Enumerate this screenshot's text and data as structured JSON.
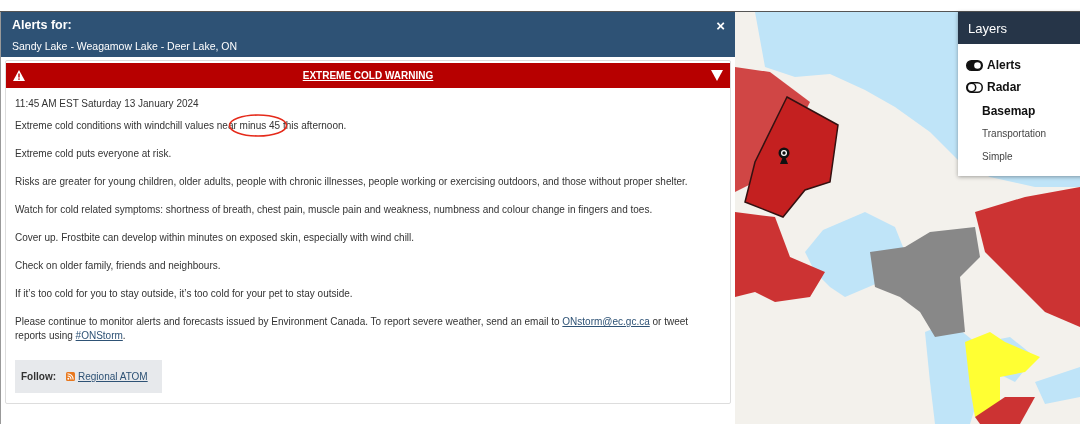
{
  "alert_panel": {
    "title": "Alerts for:",
    "location": "Sandy Lake - Weagamow Lake - Deer Lake, ON",
    "close": "×",
    "warning": {
      "title": "EXTREME COLD WARNING"
    },
    "issued": "11:45 AM EST Saturday 13 January 2024",
    "paragraphs": [
      [
        {
          "kind": "text",
          "text": "Extreme cold conditions with windchill values near "
        },
        {
          "kind": "circled",
          "text": "minus 45"
        },
        {
          "kind": "text",
          "text": " this afternoon."
        }
      ],
      [
        {
          "kind": "text",
          "text": "Extreme cold puts everyone at risk."
        }
      ],
      [
        {
          "kind": "text",
          "text": "Risks are greater for young children, older adults, people with chronic illnesses, people working or exercising outdoors, and those without proper shelter."
        }
      ],
      [
        {
          "kind": "text",
          "text": "Watch for cold related symptoms: shortness of breath, chest pain, muscle pain and weakness, numbness and colour change in fingers and toes."
        }
      ],
      [
        {
          "kind": "text",
          "text": "Cover up. Frostbite can develop within minutes on exposed skin, especially with wind chill."
        }
      ],
      [
        {
          "kind": "text",
          "text": "Check on older family, friends and neighbours."
        }
      ],
      [
        {
          "kind": "text",
          "text": "If it’s too cold for you to stay outside, it’s too cold for your pet to stay outside."
        }
      ],
      [
        {
          "kind": "text",
          "text": "Please continue to monitor alerts and forecasts issued by Environment Canada. To report severe weather, send an email to "
        },
        {
          "kind": "link",
          "text": "ONstorm@ec.gc.ca"
        },
        {
          "kind": "text",
          "text": " or tweet reports using "
        },
        {
          "kind": "link",
          "text": "#ONStorm"
        },
        {
          "kind": "text",
          "text": "."
        }
      ]
    ],
    "follow": {
      "label": "Follow:",
      "link": "Regional ATOM"
    }
  },
  "layers": {
    "title": "Layers",
    "toggles": [
      {
        "label": "Alerts",
        "on": true
      },
      {
        "label": "Radar",
        "on": false
      }
    ],
    "basemap": {
      "title": "Basemap",
      "options": [
        "Transportation",
        "Simple"
      ]
    }
  }
}
